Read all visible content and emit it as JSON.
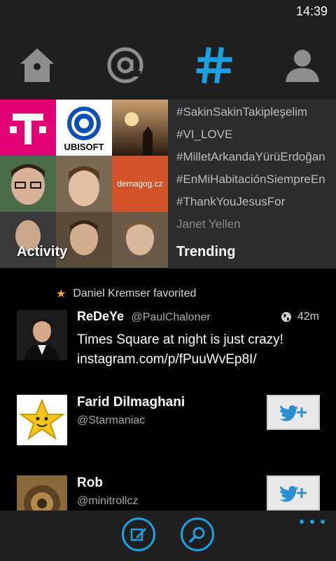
{
  "status_bar": {
    "time": "14:39"
  },
  "nav": {
    "items": [
      {
        "icon": "home-icon",
        "active": false
      },
      {
        "icon": "mention-icon",
        "active": false
      },
      {
        "icon": "hashtag-icon",
        "active": true
      },
      {
        "icon": "profile-icon",
        "active": false
      }
    ],
    "active_color": "#1ba1e2",
    "inactive_color": "#8e8e8e"
  },
  "activity": {
    "label": "Activity",
    "tiles": [
      {
        "caption": "T",
        "color": "#e20074"
      },
      {
        "caption": "UBISOFT",
        "color": "#ffffff"
      },
      {
        "caption": "",
        "color": "#8a5a2a"
      },
      {
        "caption": "",
        "color": "#4c6b4a"
      },
      {
        "caption": "",
        "color": "#7a6a55"
      },
      {
        "caption": "demagog.cz",
        "color": "#d2532a"
      },
      {
        "caption": "",
        "color": "#3a3a3a"
      },
      {
        "caption": "",
        "color": "#5a4a3a"
      },
      {
        "caption": "",
        "color": "#6a5a4a"
      }
    ]
  },
  "trending": {
    "label": "Trending",
    "items": [
      "#SakinSakinTakipleşelim",
      "#VI_LOVE",
      "#MilletArkandaYürüErdoğan",
      "#EnMiHabitaciónSiempreEn",
      "#ThankYouJesusFor",
      "Janet Yellen"
    ]
  },
  "feed": {
    "favorited_by": "Daniel Kremser favorited",
    "tweet": {
      "name": "ReDeYe",
      "handle": "@PaulChaloner",
      "age": "42m",
      "text_line1": "Times Square at night is just crazy!",
      "text_line2": "instagram.com/p/fPuuWvEp8I/"
    },
    "suggestions": [
      {
        "name": "Farid Dilmaghani",
        "handle": "@Starmaniac"
      },
      {
        "name": "Rob",
        "handle": "@minitrollcz"
      }
    ]
  },
  "app_bar": {
    "buttons": [
      "compose-icon",
      "search-icon"
    ],
    "more": "more-icon"
  }
}
